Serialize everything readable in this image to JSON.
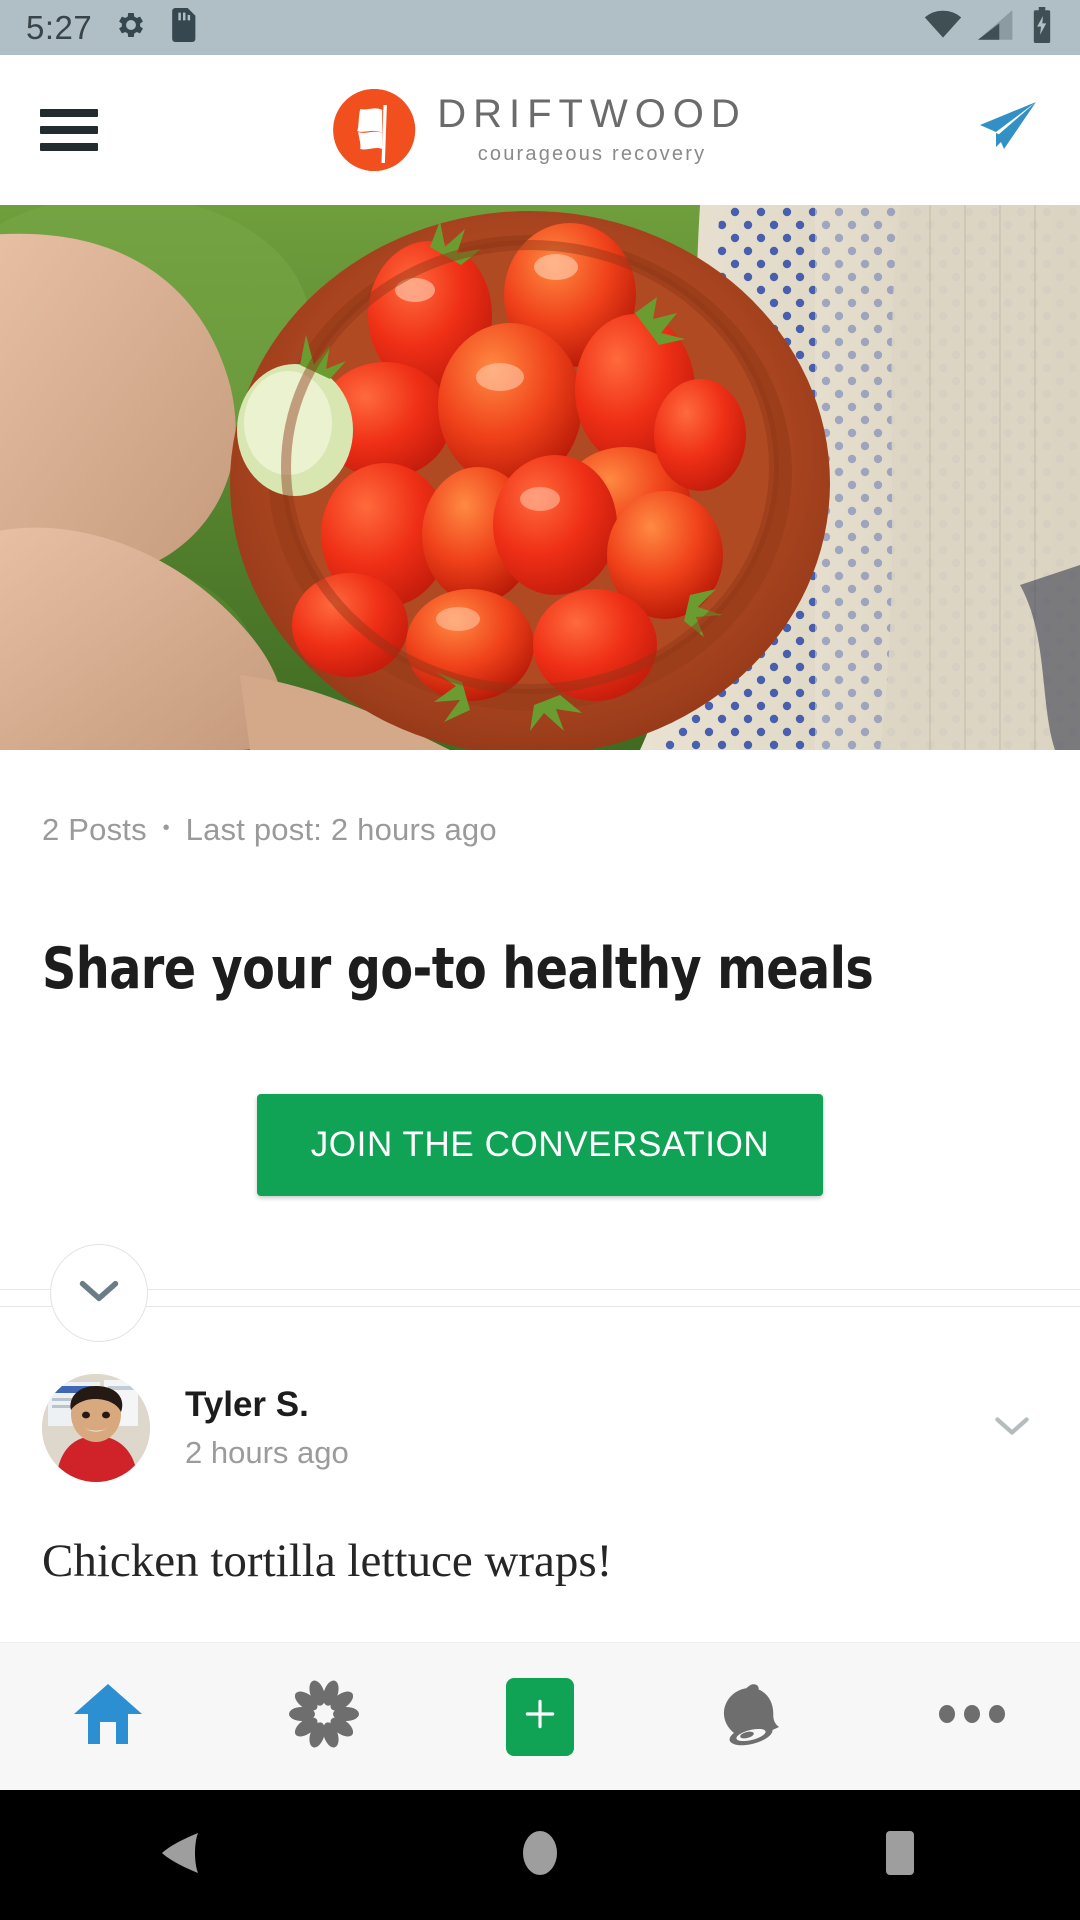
{
  "status_bar": {
    "time": "5:27",
    "icons": [
      "gear-icon",
      "sd-card-icon",
      "wifi-icon",
      "cellular-signal-icon",
      "battery-charging-icon"
    ]
  },
  "header": {
    "menu_icon": "hamburger-menu-icon",
    "brand_name": "DRIFTWOOD",
    "brand_tagline": "courageous recovery",
    "brand_mark": "flag-logo-icon",
    "send_icon": "send-paper-plane-icon",
    "brand_color": "#f1501e",
    "send_color": "#3290c4"
  },
  "hero": {
    "alt": "hands-holding-bowl-of-tomatoes-image"
  },
  "topic": {
    "post_count": "2 Posts",
    "separator": "•",
    "last_post": "Last post: 2 hours ago",
    "title": "Share your go-to healthy meals",
    "cta_label": "JOIN THE CONVERSATION",
    "cta_color": "#10a355",
    "expand_icon": "chevron-down-icon"
  },
  "post": {
    "author": "Tyler S.",
    "timestamp": "2 hours ago",
    "body": "Chicken tortilla lettuce wraps!",
    "avatar": "user-avatar-image",
    "menu_icon": "chevron-down-icon"
  },
  "bottom_nav": {
    "items": [
      {
        "name": "home",
        "icon": "home-icon",
        "active": true
      },
      {
        "name": "explore",
        "icon": "pinwheel-flower-icon",
        "active": false
      },
      {
        "name": "create",
        "icon": "plus-icon",
        "active": false
      },
      {
        "name": "notifications",
        "icon": "bell-icon",
        "active": false
      },
      {
        "name": "more",
        "icon": "more-horizontal-icon",
        "active": false
      }
    ],
    "active_color": "#2b8fd1",
    "inactive_color": "#6e6e6e"
  },
  "android_nav": {
    "back": "back-triangle-icon",
    "home": "home-circle-icon",
    "recents": "recents-square-icon"
  }
}
